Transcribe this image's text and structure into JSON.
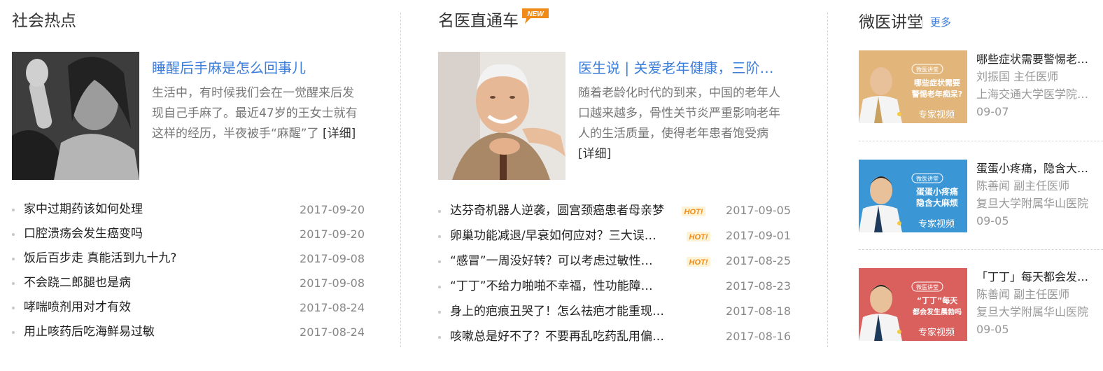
{
  "section1": {
    "title": "社会热点",
    "feature": {
      "title": "睡醒后手麻是怎么回事儿",
      "desc": "生活中，有时候我们会在一觉醒来后发现自己手麻了。最近47岁的王女士就有这样的经历，半夜被手“麻醒”了",
      "more": "[详细]"
    },
    "items": [
      {
        "title": "家中过期药该如何处理",
        "date": "2017-09-20"
      },
      {
        "title": "口腔溃疡会发生癌变吗",
        "date": "2017-09-20"
      },
      {
        "title": "饭后百步走 真能活到九十九?",
        "date": "2017-09-08"
      },
      {
        "title": "不会跷二郎腿也是病",
        "date": "2017-09-08"
      },
      {
        "title": "哮喘喷剂用对才有效",
        "date": "2017-08-24"
      },
      {
        "title": "用止咳药后吃海鲜易过敏",
        "date": "2017-08-24"
      }
    ]
  },
  "section2": {
    "title": "名医直通车",
    "badge": "NEW",
    "feature": {
      "title": "医生说 | 关爱老年健康，三阶…",
      "desc": "随着老龄化时代的到来，中国的老年人口越来越多，骨性关节炎严重影响老年人的生活质量，使得老年患者饱受病",
      "more": "[详细]"
    },
    "items": [
      {
        "title": "达芬奇机器人逆袭，圆宫颈癌患者母亲梦",
        "date": "2017-09-05",
        "hot": "HOT!"
      },
      {
        "title": "卵巢功能减退/早衰如何应对？三大误…",
        "date": "2017-09-01",
        "hot": "HOT!"
      },
      {
        "title": "“感冒”一周没好转？可以考虑过敏性…",
        "date": "2017-08-25",
        "hot": "HOT!"
      },
      {
        "title": "“丁丁”不给力啪啪不幸福，性功能障…",
        "date": "2017-08-23"
      },
      {
        "title": "身上的疤痕丑哭了！怎么祛疤才能重现…",
        "date": "2017-08-18"
      },
      {
        "title": "咳嗽总是好不了？不要再乱吃药乱用偏…",
        "date": "2017-08-16"
      }
    ]
  },
  "section3": {
    "title": "微医讲堂",
    "more": "更多",
    "items": [
      {
        "title": "哪些症状需要警惕老…",
        "doctor": "刘振国 主任医师",
        "hospital": "上海交通大学医学院…",
        "date": "09-07",
        "thumb": {
          "bg": "#e2b57a",
          "logo": "微医讲堂",
          "lines": [
            "哪些症状需要",
            "警惕老年痴呆?"
          ],
          "tag": "专家视频"
        }
      },
      {
        "title": "蛋蛋小疼痛，隐含大…",
        "doctor": "陈善闻 副主任医师",
        "hospital": "复旦大学附属华山医院",
        "date": "09-05",
        "thumb": {
          "bg": "#3a96d4",
          "logo": "微医讲堂",
          "lines": [
            "蛋蛋小疼痛",
            "隐含大麻烦"
          ],
          "tag": "专家视频"
        }
      },
      {
        "title": "「丁丁」每天都会发…",
        "doctor": "陈善闻 副主任医师",
        "hospital": "复旦大学附属华山医院",
        "date": "09-05",
        "thumb": {
          "bg": "#d9605c",
          "logo": "微医讲堂",
          "lines": [
            "“丁丁”每天",
            "都会发生晨勃吗"
          ],
          "tag": "专家视频"
        }
      }
    ]
  },
  "colors": {
    "link": "#3c7ddb",
    "badge": "#f08a18",
    "hot": "#f08a18"
  }
}
